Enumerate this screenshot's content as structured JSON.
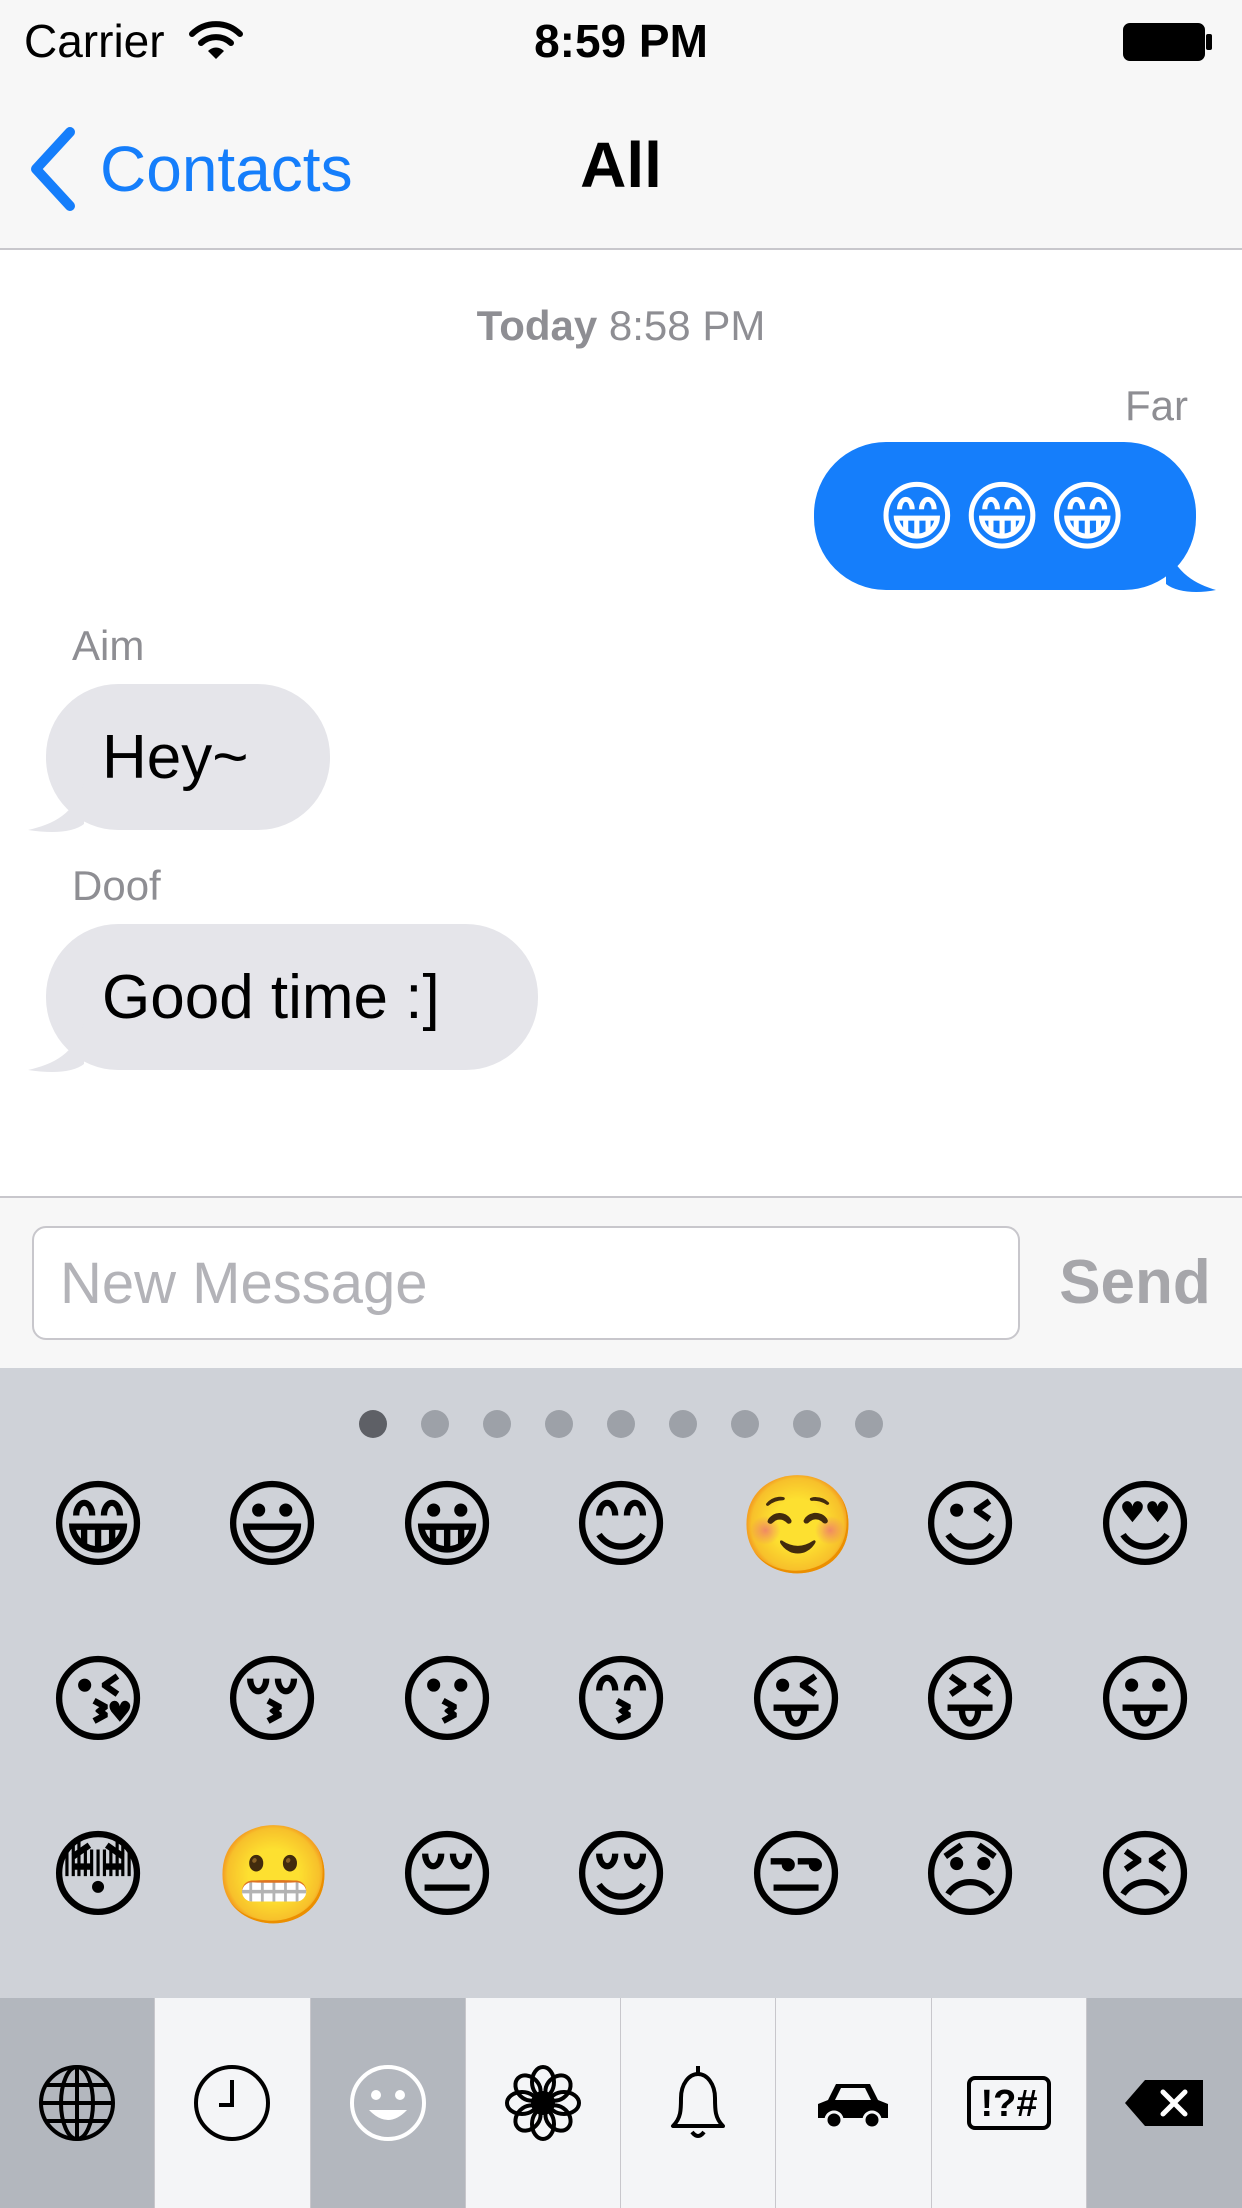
{
  "status_bar": {
    "carrier": "Carrier",
    "time": "8:59 PM",
    "wifi_icon": "wifi-icon",
    "battery_icon": "battery-icon"
  },
  "nav": {
    "back_label": "Contacts",
    "title": "All",
    "accent_color": "#157efb"
  },
  "conversation": {
    "timestamp_day": "Today",
    "timestamp_time": "8:58 PM",
    "messages": [
      {
        "sender": "Far",
        "text": "😁😁😁",
        "direction": "outgoing"
      },
      {
        "sender": "Aim",
        "text": "Hey~",
        "direction": "incoming"
      },
      {
        "sender": "Doof",
        "text": "Good time :]",
        "direction": "incoming"
      }
    ]
  },
  "composer": {
    "placeholder": "New Message",
    "value": "",
    "send_label": "Send"
  },
  "keyboard": {
    "page_count": 9,
    "active_page": 1,
    "emojis": [
      "😁",
      "😃",
      "😀",
      "😊",
      "☺️",
      "😉",
      "😍",
      "😘",
      "😚",
      "😗",
      "😙",
      "😜",
      "😝",
      "😛",
      "😳",
      "😬",
      "😔",
      "😌",
      "😒",
      "😞",
      "😣"
    ],
    "categories": [
      {
        "icon": "globe-icon",
        "selected": false
      },
      {
        "icon": "clock-icon",
        "selected": false
      },
      {
        "icon": "smiley-icon",
        "selected": true
      },
      {
        "icon": "flower-icon",
        "selected": false
      },
      {
        "icon": "bell-icon",
        "selected": false
      },
      {
        "icon": "car-icon",
        "selected": false
      },
      {
        "icon": "symbols-icon",
        "selected": false,
        "label": "!?#"
      },
      {
        "icon": "delete-icon",
        "selected": false
      }
    ]
  }
}
